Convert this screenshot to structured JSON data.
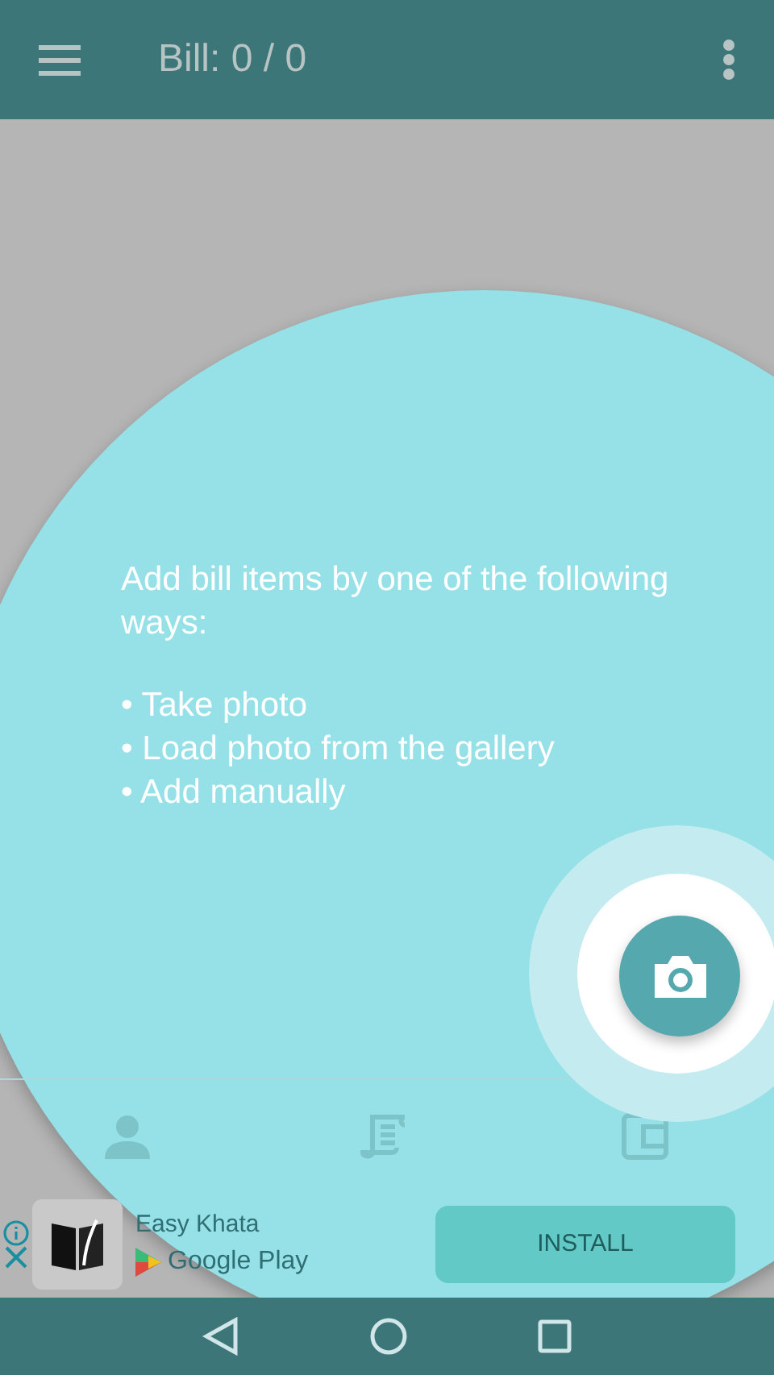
{
  "app_bar": {
    "title": "Bill: 0 / 0"
  },
  "tutorial": {
    "heading": "Add bill items by one of the following ways:",
    "items": [
      "• Take photo",
      "• Load photo from the gallery",
      "• Add manually"
    ]
  },
  "ad": {
    "app_name": "Easy Khata",
    "store": "Google Play",
    "button": "INSTALL"
  }
}
